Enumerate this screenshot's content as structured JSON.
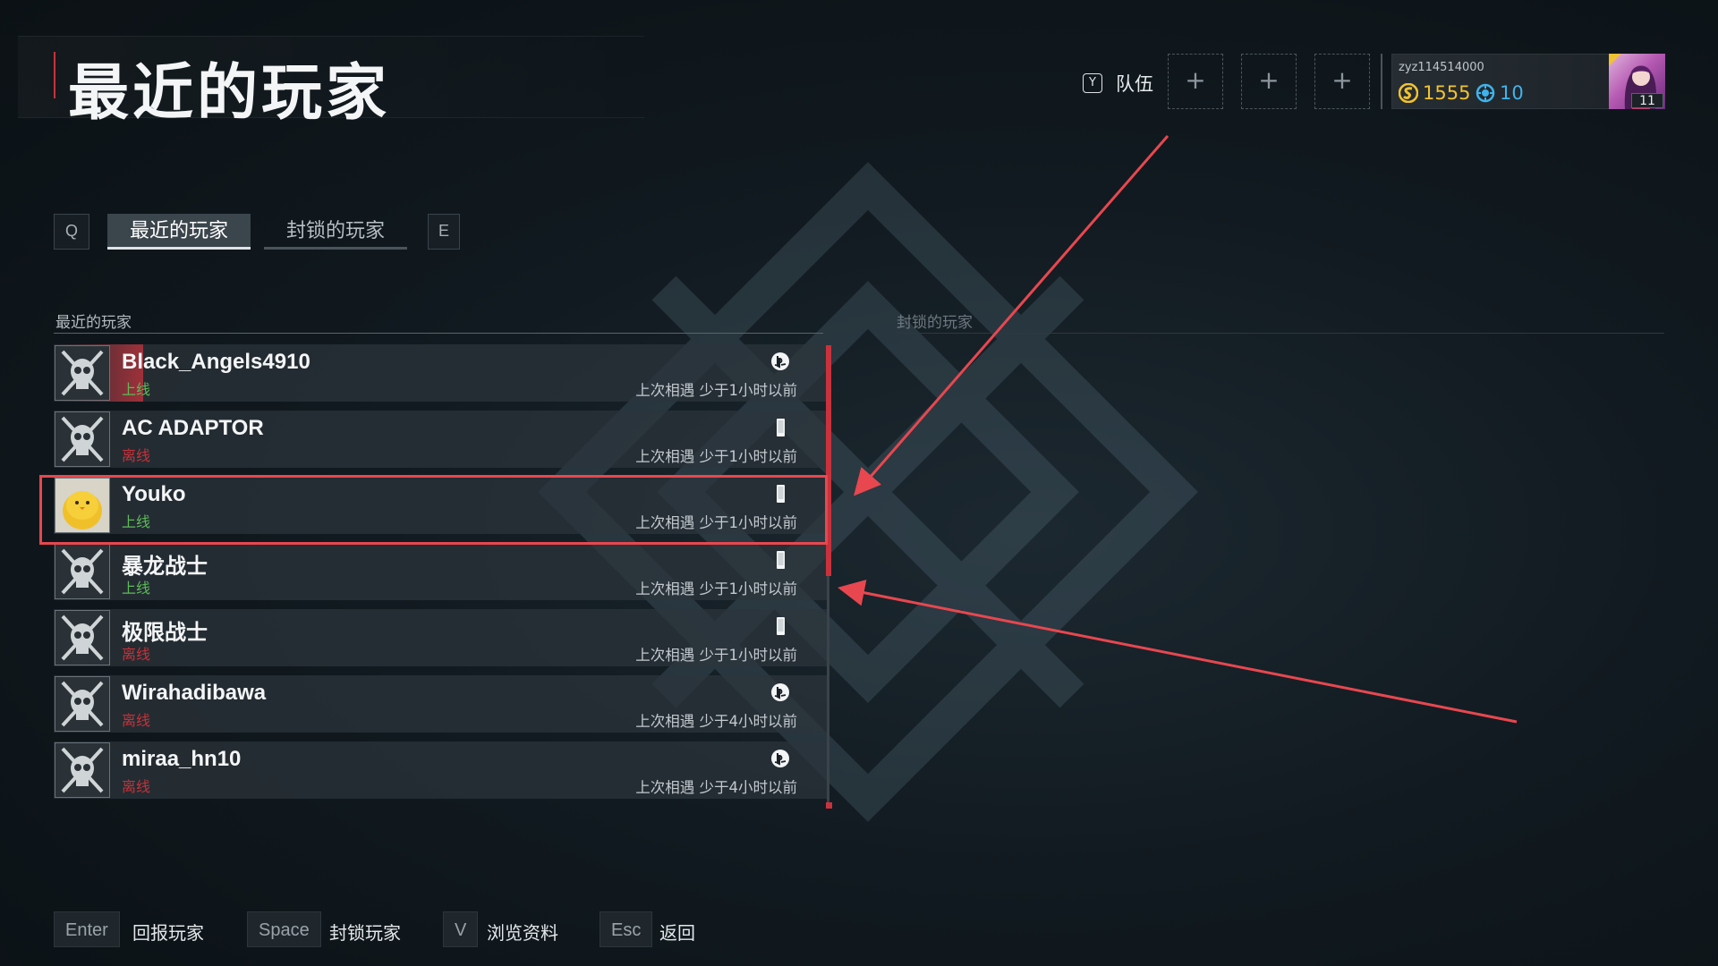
{
  "page": {
    "title": "最近的玩家"
  },
  "header": {
    "team_key": "Y",
    "team_label": "队伍",
    "slot_plus": "+",
    "profile": {
      "username": "zyz114514000",
      "coins": "1555",
      "tickets": "10",
      "level": "11",
      "coin_color": "#f2c230",
      "ticket_color": "#3fb4ea"
    }
  },
  "tabs": {
    "prev_key": "Q",
    "next_key": "E",
    "items": [
      {
        "label": "最近的玩家",
        "active": true
      },
      {
        "label": "封锁的玩家",
        "active": false
      }
    ]
  },
  "sections": {
    "left_title": "最近的玩家",
    "right_title": "封锁的玩家"
  },
  "players": [
    {
      "name": "Black_Angels4910",
      "status": "上线",
      "online": true,
      "platform": "playstation-icon",
      "last_met": "上次相遇 少于1小时以前",
      "avatar": "skull-avatar-icon"
    },
    {
      "name": "AC ADAPTOR",
      "status": "离线",
      "online": false,
      "platform": "mobile-icon",
      "last_met": "上次相遇 少于1小时以前",
      "avatar": "skull-avatar-icon"
    },
    {
      "name": "Youko",
      "status": "上线",
      "online": true,
      "platform": "mobile-icon",
      "last_met": "上次相遇 少于1小时以前",
      "avatar": "chick-avatar-icon"
    },
    {
      "name": "暴龙战士",
      "status": "上线",
      "online": true,
      "platform": "mobile-icon",
      "last_met": "上次相遇 少于1小时以前",
      "avatar": "skull-avatar-icon"
    },
    {
      "name": "极限战士",
      "status": "离线",
      "online": false,
      "platform": "mobile-icon",
      "last_met": "上次相遇 少于1小时以前",
      "avatar": "skull-avatar-icon"
    },
    {
      "name": "Wirahadibawa",
      "status": "离线",
      "online": false,
      "platform": "playstation-icon",
      "last_met": "上次相遇 少于4小时以前",
      "avatar": "skull-avatar-icon"
    },
    {
      "name": "miraa_hn10",
      "status": "离线",
      "online": false,
      "platform": "playstation-icon",
      "last_met": "上次相遇 少于4小时以前",
      "avatar": "skull-avatar-icon"
    }
  ],
  "footer": [
    {
      "key": "Enter",
      "label": "回报玩家"
    },
    {
      "key": "Space",
      "label": "封锁玩家"
    },
    {
      "key": "V",
      "label": "浏览资料"
    },
    {
      "key": "Esc",
      "label": "返回"
    }
  ],
  "colors": {
    "accent": "#c8323c",
    "online": "#5dbb58",
    "offline": "#c6323a",
    "annotation": "#e8474f"
  }
}
